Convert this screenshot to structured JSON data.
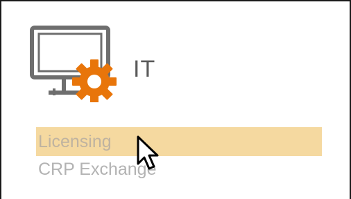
{
  "tile": {
    "title": "IT",
    "icon": "monitor-gear-icon"
  },
  "menu": {
    "items": [
      {
        "label": "Licensing",
        "state": "hovered"
      },
      {
        "label": "CRP Exchange",
        "state": "normal"
      }
    ]
  },
  "colors": {
    "highlight": "#f5d9a0",
    "gear": "#e8750a",
    "monitor": "#6e6e6e",
    "item_text": "#b3b3b3",
    "title_text": "#5a5a5a"
  },
  "cursor": "arrow-pointer-icon"
}
